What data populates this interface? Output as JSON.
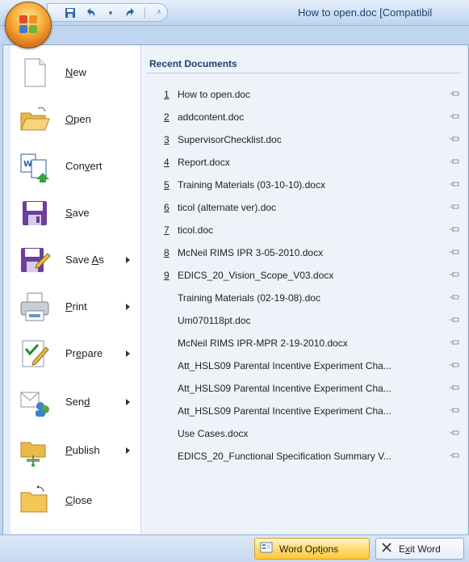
{
  "window": {
    "title": "How to open.doc [Compatibil"
  },
  "quick_access": {
    "save_icon": "save-icon",
    "undo_icon": "undo-icon",
    "redo_icon": "redo-icon",
    "customize_icon": "customize-icon"
  },
  "commands": [
    {
      "label": "New",
      "ul": "N",
      "rest": "ew",
      "icon": "new-document-icon",
      "has_submenu": false
    },
    {
      "label": "Open",
      "ul": "O",
      "rest": "pen",
      "icon": "open-folder-icon",
      "has_submenu": false
    },
    {
      "label": "Convert",
      "pre": "Con",
      "ul": "v",
      "rest": "ert",
      "icon": "convert-icon",
      "has_submenu": false
    },
    {
      "label": "Save",
      "ul": "S",
      "rest": "ave",
      "icon": "save-disk-icon",
      "has_submenu": false
    },
    {
      "label": "Save As",
      "pre": "Save ",
      "ul": "A",
      "rest": "s",
      "icon": "save-as-icon",
      "has_submenu": true
    },
    {
      "label": "Print",
      "ul": "P",
      "rest": "rint",
      "icon": "printer-icon",
      "has_submenu": true
    },
    {
      "label": "Prepare",
      "pre": "Pr",
      "ul": "e",
      "rest": "pare",
      "icon": "prepare-icon",
      "has_submenu": true
    },
    {
      "label": "Send",
      "pre": "Sen",
      "ul": "d",
      "rest": "",
      "icon": "send-icon",
      "has_submenu": true
    },
    {
      "label": "Publish",
      "ul": "P",
      "rest": "ublish",
      "icon": "publish-icon",
      "has_submenu": true
    },
    {
      "label": "Close",
      "ul": "C",
      "rest": "lose",
      "icon": "close-folder-icon",
      "has_submenu": false
    }
  ],
  "recent": {
    "header": "Recent Documents",
    "items": [
      {
        "num": "1",
        "name": "How to open.doc"
      },
      {
        "num": "2",
        "name": "addcontent.doc"
      },
      {
        "num": "3",
        "name": "SupervisorChecklist.doc"
      },
      {
        "num": "4",
        "name": "Report.docx"
      },
      {
        "num": "5",
        "name": "Training Materials (03-10-10).docx"
      },
      {
        "num": "6",
        "name": "ticol (alternate ver).doc"
      },
      {
        "num": "7",
        "name": "ticol.doc"
      },
      {
        "num": "8",
        "name": "McNeil RIMS IPR 3-05-2010.docx"
      },
      {
        "num": "9",
        "name": "EDICS_20_Vision_Scope_V03.docx"
      },
      {
        "num": "",
        "name": "Training Materials (02-19-08).doc"
      },
      {
        "num": "",
        "name": "Um070118pt.doc"
      },
      {
        "num": "",
        "name": "McNeil RIMS IPR-MPR 2-19-2010.docx"
      },
      {
        "num": "",
        "name": "Att_HSLS09 Parental Incentive Experiment Cha..."
      },
      {
        "num": "",
        "name": "Att_HSLS09 Parental Incentive Experiment Cha..."
      },
      {
        "num": "",
        "name": "Att_HSLS09  Parental Incentive Experiment Cha..."
      },
      {
        "num": "",
        "name": "Use Cases.docx"
      },
      {
        "num": "",
        "name": "EDICS_20_Functional Specification Summary V..."
      }
    ],
    "pin_icon": "pin-icon"
  },
  "footer": {
    "word_options": {
      "pre": "Word Opt",
      "ul": "i",
      "rest": "ons",
      "label": "Word Options",
      "icon": "options-icon"
    },
    "exit_word": {
      "pre": "E",
      "ul": "x",
      "rest": "it Word",
      "label": "Exit Word",
      "icon": "x-icon"
    }
  },
  "colors": {
    "accent": "#ffc83c",
    "frame": "#bfd6ee"
  }
}
